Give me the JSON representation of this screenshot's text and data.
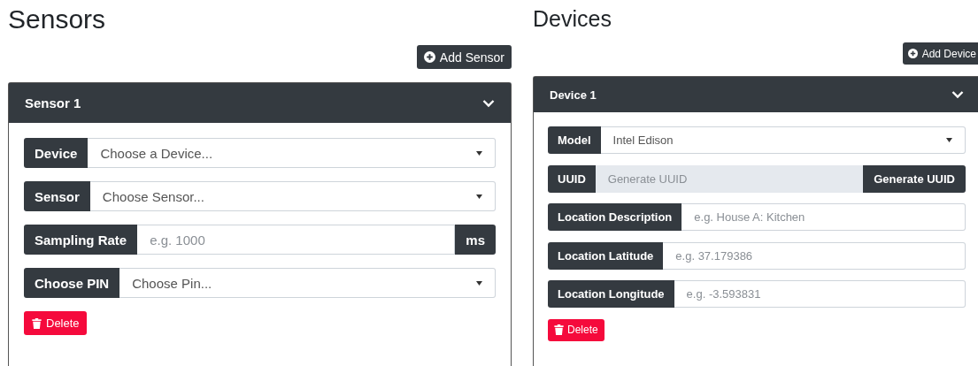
{
  "sections": [
    {
      "title": "Sensors",
      "add_button": "Add Sensor",
      "panels": [
        {
          "title": "Sensor 1",
          "expanded": true,
          "rows": [
            {
              "kind": "select",
              "label": "Device",
              "value": "Choose a Device..."
            },
            {
              "kind": "select",
              "label": "Sensor",
              "value": "Choose Sensor..."
            },
            {
              "kind": "unit",
              "label": "Sampling Rate",
              "placeholder": "e.g. 1000",
              "unit": "ms"
            },
            {
              "kind": "select",
              "label": "Choose PIN",
              "value": "Choose Pin..."
            }
          ],
          "delete_button": "Delete"
        }
      ]
    },
    {
      "title": "Devices",
      "add_button": "Add Device",
      "panels": [
        {
          "title": "Device 1",
          "expanded": true,
          "rows": [
            {
              "kind": "select",
              "label": "Model",
              "value": "Intel Edison"
            },
            {
              "kind": "action",
              "label": "UUID",
              "placeholder": "Generate UUID",
              "button": "Generate UUID"
            },
            {
              "kind": "text",
              "label": "Location Description",
              "placeholder": "e.g. House A: Kitchen"
            },
            {
              "kind": "text",
              "label": "Location Latitude",
              "placeholder": "e.g. 37.179386"
            },
            {
              "kind": "text",
              "label": "Location Longitude",
              "placeholder": "e.g. -3.593831"
            }
          ],
          "delete_button": "Delete"
        }
      ]
    }
  ]
}
